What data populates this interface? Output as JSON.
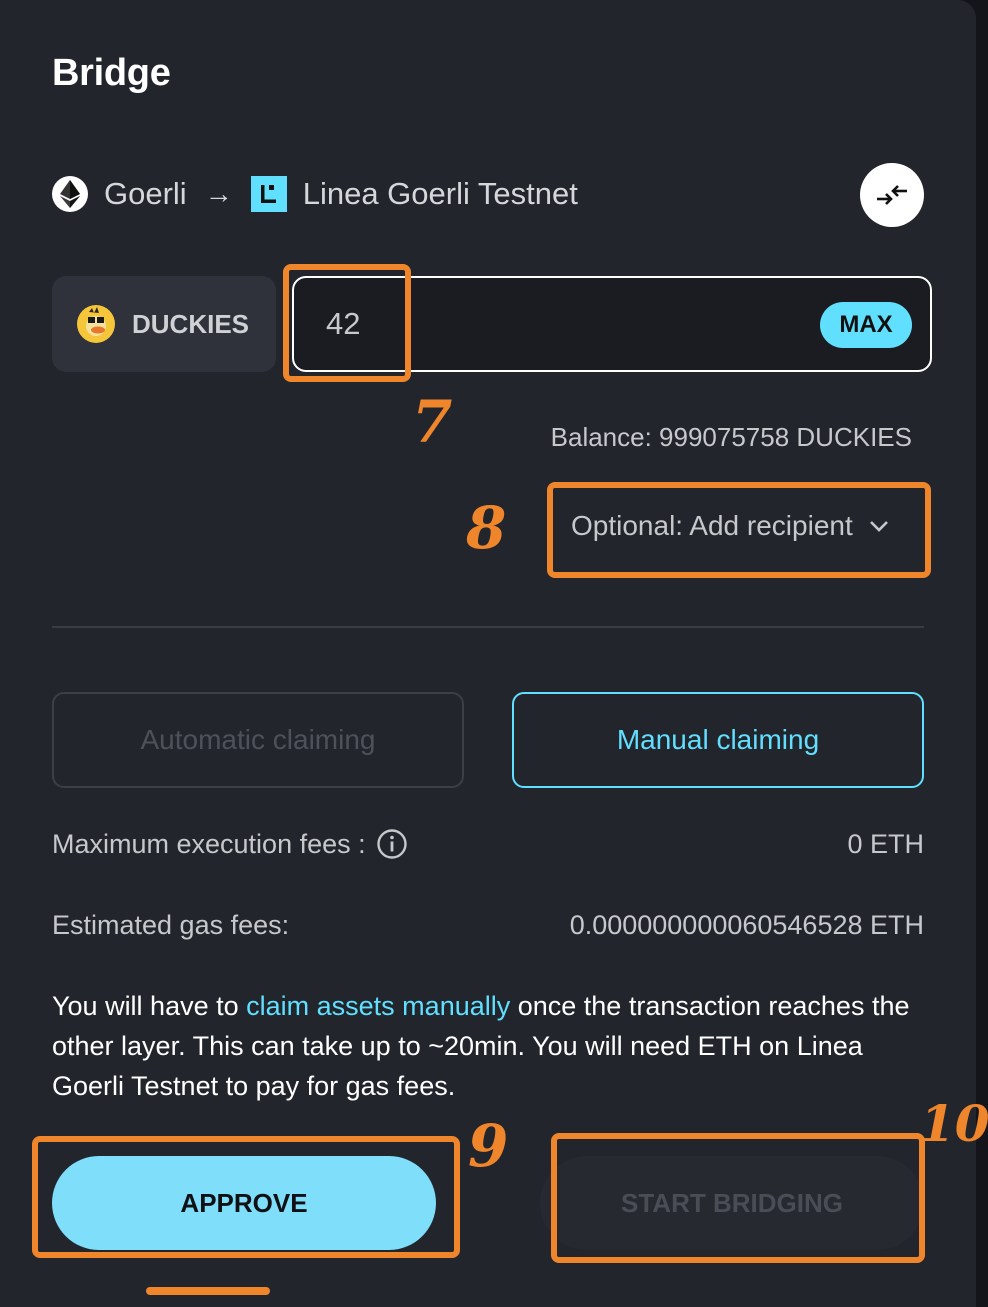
{
  "header": {
    "title": "Bridge"
  },
  "route": {
    "from_network": "Goerli",
    "arrow": "→",
    "to_network": "Linea Goerli Testnet",
    "from_icon": "ethereum-icon",
    "to_icon": "linea-icon",
    "swap_icon": "swap-arrows-icon"
  },
  "token": {
    "symbol": "DUCKIES",
    "icon": "duckies-token-icon"
  },
  "amount": {
    "value": "42",
    "max_label": "MAX"
  },
  "balance": {
    "text": "Balance: 999075758 DUCKIES"
  },
  "recipient": {
    "label": "Optional: Add recipient",
    "icon": "chevron-down-icon"
  },
  "claiming": {
    "automatic_label": "Automatic claiming",
    "manual_label": "Manual claiming",
    "selected": "manual"
  },
  "fees": {
    "max_execution_label": "Maximum execution fees :",
    "max_execution_value": "0 ETH",
    "estimated_gas_label": "Estimated gas fees:",
    "estimated_gas_value": "0.000000000060546528 ETH"
  },
  "note": {
    "prefix": "You will have to ",
    "link": "claim assets manually",
    "suffix": " once the transaction reaches the other layer. This can take up to ~20min. You will need ETH on Linea Goerli Testnet to pay for gas fees."
  },
  "actions": {
    "approve_label": "APPROVE",
    "start_bridging_label": "START BRIDGING"
  },
  "annotations": {
    "n7": "7",
    "n8": "8",
    "n9": "9",
    "n10": "10",
    "color": "#f0862b"
  },
  "colors": {
    "accent": "#61dfff",
    "panel": "#22252c",
    "annotation": "#f0862b"
  }
}
